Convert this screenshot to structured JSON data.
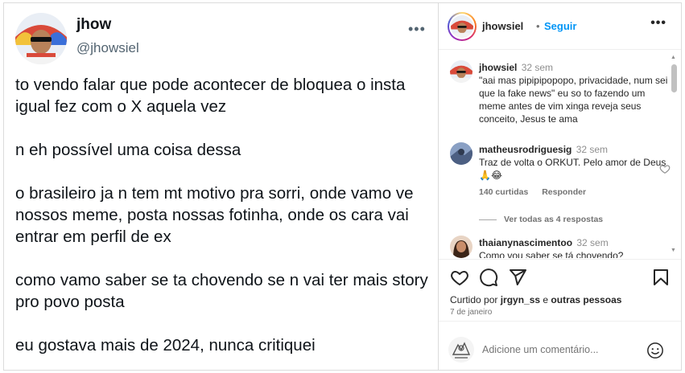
{
  "tweet": {
    "name": "jhow",
    "handle": "@jhowsiel",
    "more_label": "•••",
    "paragraphs": [
      "to vendo falar que pode acontecer de bloquea o insta igual fez com o X aquela vez",
      "n eh possível uma coisa dessa",
      "o brasileiro ja n tem mt motivo pra sorri, onde vamo ve nossos meme, posta nossas fotinha, onde os cara vai entrar em perfil de ex",
      "como vamo saber se ta chovendo se n vai ter mais story pro povo posta",
      "eu gostava mais de 2024, nunca critiquei"
    ]
  },
  "post": {
    "username": "jhowsiel",
    "dot": "•",
    "follow_label": "Seguir",
    "more_label": "•••"
  },
  "comments": [
    {
      "user": "jhowsiel",
      "time": "32 sem",
      "text": "\"aai mas pipipipopopo, privacidade, num sei que la fake news\" eu so to fazendo um meme antes de vim xinga reveja seus conceito, Jesus te ama"
    },
    {
      "user": "matheusrodriguesig",
      "time": "32 sem",
      "text": "Traz de volta o ORKUT. Pelo amor de Deus 🙏😂",
      "likes": "140 curtidas",
      "reply_label": "Responder"
    },
    {
      "user": "thaianynascimentoo",
      "time": "32 sem",
      "text": "Como vou saber se tá chovendo?"
    }
  ],
  "view_replies": "Ver todas as 4 respostas",
  "actions": {
    "liked_prefix": "Curtido por ",
    "liked_user": "jrgyn_ss",
    "liked_mid": " e ",
    "liked_others": "outras pessoas",
    "date": "7 de janeiro"
  },
  "add_comment": {
    "placeholder": "Adicione um comentário..."
  },
  "icons": {
    "like": "heart-icon",
    "comment": "comment-icon",
    "share": "send-icon",
    "save": "bookmark-icon",
    "emoji": "emoji-icon"
  },
  "colors": {
    "accent": "#0095f6",
    "text": "#262626",
    "muted": "#737373"
  }
}
